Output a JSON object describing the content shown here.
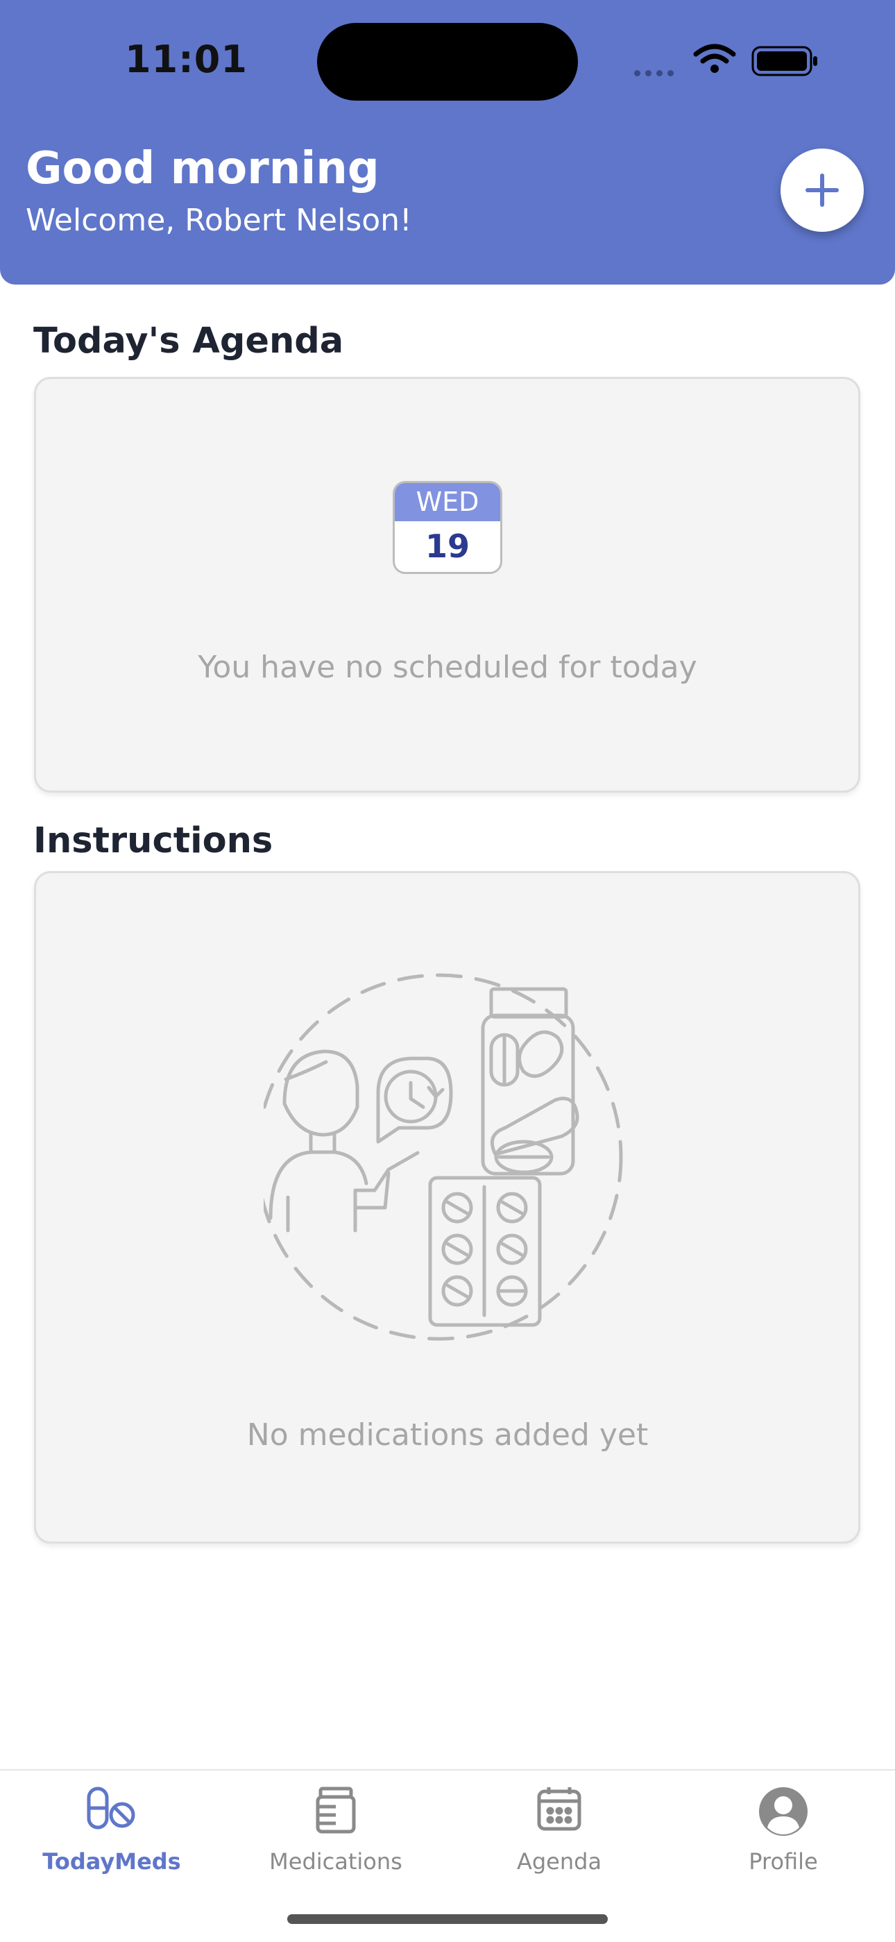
{
  "status_bar": {
    "time": "11:01"
  },
  "header": {
    "greeting": "Good morning",
    "welcome": "Welcome, Robert Nelson!",
    "add_icon": "plus-icon",
    "background_color": "#5f76ca"
  },
  "agenda": {
    "title": "Today's Agenda",
    "calendar_day": "WED",
    "calendar_date": "19",
    "empty_message": "You have no scheduled for today"
  },
  "instructions": {
    "title": "Instructions",
    "illustration": "doctor-pills-illustration",
    "empty_message": "No medications added yet"
  },
  "tabs": [
    {
      "label": "TodayMeds",
      "icon": "pills-icon",
      "active": true
    },
    {
      "label": "Medications",
      "icon": "medicine-bottle-icon",
      "active": false
    },
    {
      "label": "Agenda",
      "icon": "calendar-icon",
      "active": false
    },
    {
      "label": "Profile",
      "icon": "user-avatar-icon",
      "active": false
    }
  ]
}
